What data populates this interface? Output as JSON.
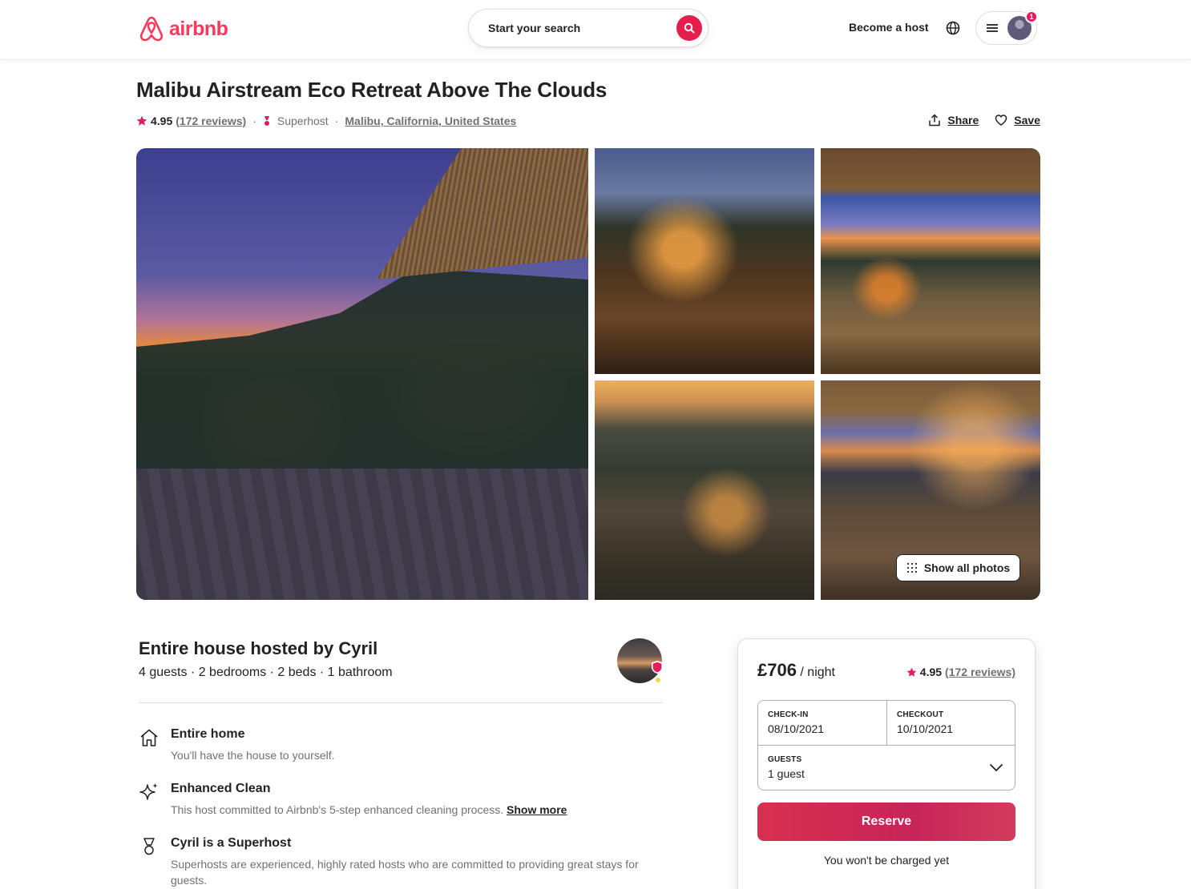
{
  "header": {
    "logo_text": "airbnb",
    "search_placeholder": "Start your search",
    "become_host": "Become a host",
    "notification_count": "1",
    "brand_color": "#FF385C"
  },
  "listing": {
    "title": "Malibu Airstream Eco Retreat Above The Clouds",
    "rating": "4.95",
    "reviews": "(172 reviews)",
    "superhost_label": "Superhost",
    "location": "Malibu, California, United States",
    "separator": "·",
    "share_label": "Share",
    "save_label": "Save"
  },
  "gallery": {
    "show_all_label": "Show all photos"
  },
  "details": {
    "host_title": "Entire house hosted by Cyril",
    "host_sub": "4 guests · 2 bedrooms · 2 beds · 1 bathroom",
    "features": [
      {
        "icon": "home-icon",
        "title": "Entire home",
        "desc": "You'll have the house to yourself."
      },
      {
        "icon": "sparkle-icon",
        "title": "Enhanced Clean",
        "desc": "This host committed to Airbnb's 5-step enhanced cleaning process.",
        "link": "Show more"
      },
      {
        "icon": "medal-icon",
        "title": "Cyril is a Superhost",
        "desc": "Superhosts are experienced, highly rated hosts who are committed to providing great stays for guests."
      }
    ]
  },
  "booking": {
    "price": "£706",
    "price_unit": " / night",
    "rating": "4.95",
    "reviews": "(172 reviews)",
    "checkin_label": "CHECK-IN",
    "checkin_value": "08/10/2021",
    "checkout_label": "CHECKOUT",
    "checkout_value": "10/10/2021",
    "guests_label": "GUESTS",
    "guests_value": "1 guest",
    "reserve_label": "Reserve",
    "charged_note": "You won't be charged yet",
    "reserve_color": "#D7304F"
  }
}
